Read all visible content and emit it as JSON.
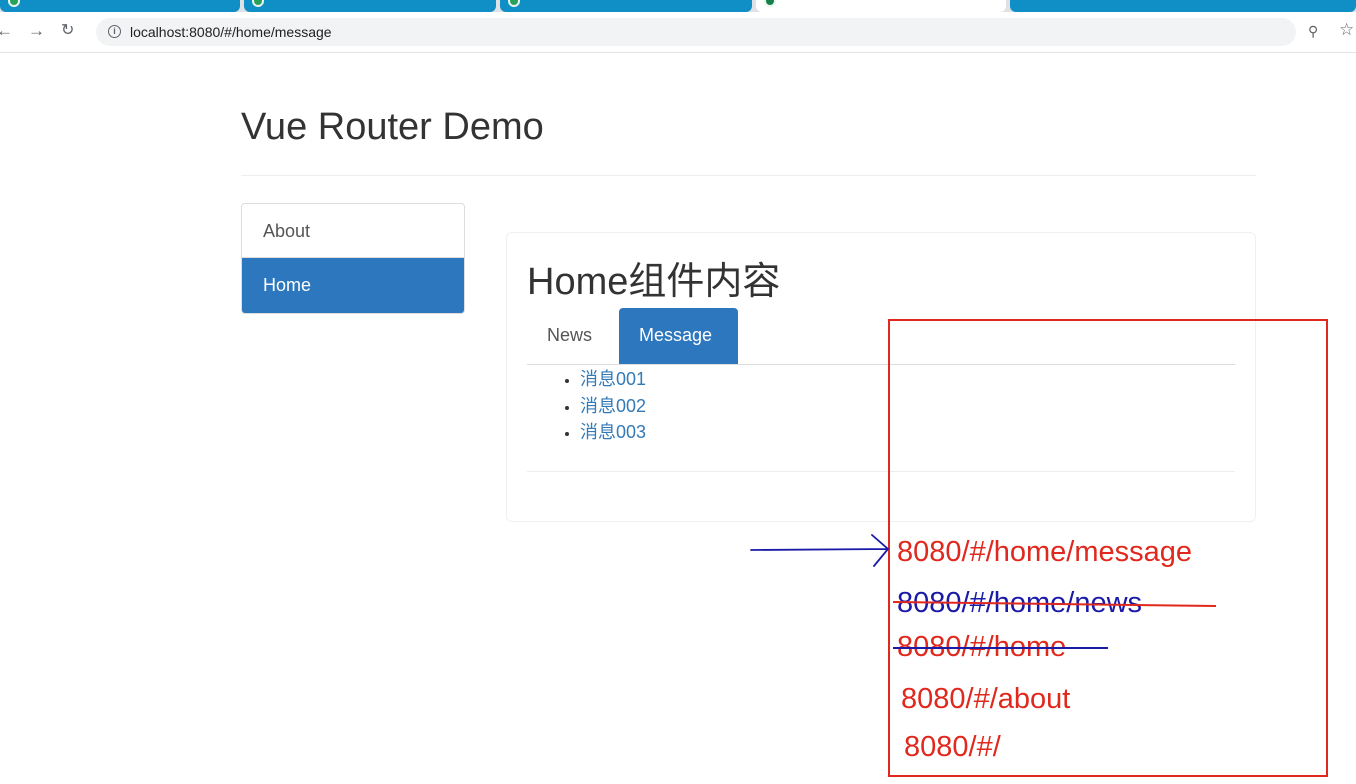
{
  "browser": {
    "url": "localhost:8080/#/home/message",
    "icons": [
      "back-icon",
      "forward-icon",
      "reload-icon",
      "info-icon",
      "zoom-icon",
      "star-icon"
    ]
  },
  "page": {
    "title": "Vue Router Demo",
    "sidenav": [
      {
        "label": "About",
        "active": false
      },
      {
        "label": "Home",
        "active": true
      }
    ],
    "home": {
      "heading": "Home组件内容",
      "tabs": [
        {
          "label": "News",
          "active": false
        },
        {
          "label": "Message",
          "active": true
        }
      ],
      "messages": [
        "消息001",
        "消息002",
        "消息003"
      ]
    }
  },
  "annotations": {
    "box_color": "#e0281d",
    "routes": [
      {
        "text": "8080/#/home/message",
        "color": "#e0281d",
        "struck": false,
        "pointed": true
      },
      {
        "text": "8080/#/home/news",
        "color": "#1a1aa8",
        "struck": true
      },
      {
        "text": "8080/#/home",
        "color": "#e0281d",
        "struck": true
      },
      {
        "text": "8080/#/about",
        "color": "#e0281d",
        "struck": false
      },
      {
        "text": "8080/#/",
        "color": "#e0281d",
        "struck": false
      }
    ],
    "arrow_color": "#1a1aa8"
  }
}
